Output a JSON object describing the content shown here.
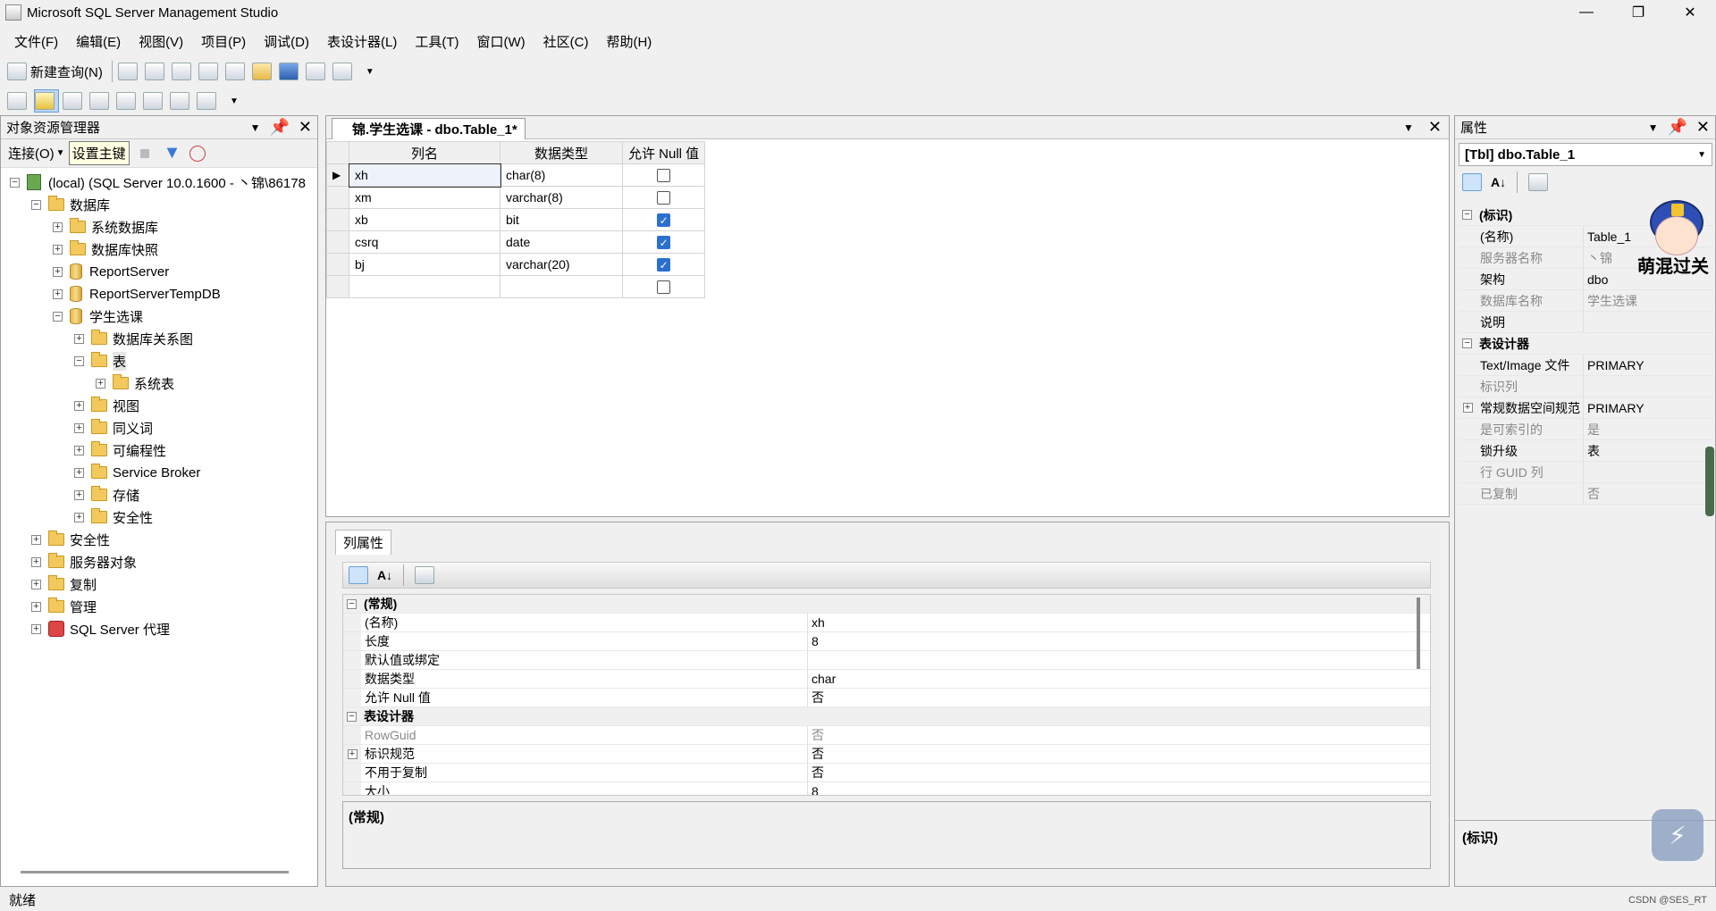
{
  "app": {
    "title": "Microsoft SQL Server Management Studio"
  },
  "menu": [
    "文件(F)",
    "编辑(E)",
    "视图(V)",
    "项目(P)",
    "调试(D)",
    "表设计器(L)",
    "工具(T)",
    "窗口(W)",
    "社区(C)",
    "帮助(H)"
  ],
  "toolbar": {
    "new_query": "新建查询(N)"
  },
  "object_explorer": {
    "title": "对象资源管理器",
    "connect": "连接(O)",
    "tooltip": "设置主键",
    "tree": [
      {
        "label": "(local) (SQL Server 10.0.1600 - 丶锦\\86178",
        "level": 0,
        "exp": "−",
        "icon": "server"
      },
      {
        "label": "数据库",
        "level": 1,
        "exp": "−",
        "icon": "folder"
      },
      {
        "label": "系统数据库",
        "level": 2,
        "exp": "+",
        "icon": "folder"
      },
      {
        "label": "数据库快照",
        "level": 2,
        "exp": "+",
        "icon": "folder"
      },
      {
        "label": "ReportServer",
        "level": 2,
        "exp": "+",
        "icon": "db"
      },
      {
        "label": "ReportServerTempDB",
        "level": 2,
        "exp": "+",
        "icon": "db"
      },
      {
        "label": "学生选课",
        "level": 2,
        "exp": "−",
        "icon": "db"
      },
      {
        "label": "数据库关系图",
        "level": 3,
        "exp": "+",
        "icon": "folder"
      },
      {
        "label": "表",
        "level": 3,
        "exp": "−",
        "icon": "folder"
      },
      {
        "label": "系统表",
        "level": 4,
        "exp": "+",
        "icon": "folder"
      },
      {
        "label": "视图",
        "level": 3,
        "exp": "+",
        "icon": "folder"
      },
      {
        "label": "同义词",
        "level": 3,
        "exp": "+",
        "icon": "folder"
      },
      {
        "label": "可编程性",
        "level": 3,
        "exp": "+",
        "icon": "folder"
      },
      {
        "label": "Service Broker",
        "level": 3,
        "exp": "+",
        "icon": "folder"
      },
      {
        "label": "存储",
        "level": 3,
        "exp": "+",
        "icon": "folder"
      },
      {
        "label": "安全性",
        "level": 3,
        "exp": "+",
        "icon": "folder"
      },
      {
        "label": "安全性",
        "level": 1,
        "exp": "+",
        "icon": "folder"
      },
      {
        "label": "服务器对象",
        "level": 1,
        "exp": "+",
        "icon": "folder"
      },
      {
        "label": "复制",
        "level": 1,
        "exp": "+",
        "icon": "folder"
      },
      {
        "label": "管理",
        "level": 1,
        "exp": "+",
        "icon": "folder"
      },
      {
        "label": "SQL Server 代理",
        "level": 1,
        "exp": "+",
        "icon": "agent"
      }
    ]
  },
  "designer": {
    "tab": "锦.学生选课 - dbo.Table_1*",
    "headers": [
      "列名",
      "数据类型",
      "允许 Null 值"
    ],
    "rows": [
      {
        "name": "xh",
        "type": "char(8)",
        "nullable": false
      },
      {
        "name": "xm",
        "type": "varchar(8)",
        "nullable": false
      },
      {
        "name": "xb",
        "type": "bit",
        "nullable": true
      },
      {
        "name": "csrq",
        "type": "date",
        "nullable": true
      },
      {
        "name": "bj",
        "type": "varchar(20)",
        "nullable": true
      },
      {
        "name": "",
        "type": "",
        "nullable": false
      }
    ]
  },
  "column_props": {
    "tab": "列属性",
    "rows": [
      {
        "kind": "cat",
        "label": "(常规)",
        "exp": "−"
      },
      {
        "label": "(名称)",
        "value": "xh"
      },
      {
        "label": "长度",
        "value": "8"
      },
      {
        "label": "默认值或绑定",
        "value": ""
      },
      {
        "label": "数据类型",
        "value": "char"
      },
      {
        "label": "允许 Null 值",
        "value": "否"
      },
      {
        "kind": "cat",
        "label": "表设计器",
        "exp": "−"
      },
      {
        "label": "RowGuid",
        "value": "否",
        "grey": true
      },
      {
        "label": "标识规范",
        "value": "否",
        "exp": "+"
      },
      {
        "label": "不用于复制",
        "value": "否"
      },
      {
        "label": "大小",
        "value": "8"
      }
    ],
    "desc_title": "(常规)"
  },
  "properties": {
    "title": "属性",
    "object": "[Tbl] dbo.Table_1",
    "rows": [
      {
        "kind": "cat",
        "label": "(标识)",
        "exp": "−"
      },
      {
        "label": "(名称)",
        "value": "Table_1"
      },
      {
        "label": "服务器名称",
        "value": "丶锦",
        "grey": true
      },
      {
        "label": "架构",
        "value": "dbo"
      },
      {
        "label": "数据库名称",
        "value": "学生选课",
        "grey": true
      },
      {
        "label": "说明",
        "value": ""
      },
      {
        "kind": "cat",
        "label": "表设计器",
        "exp": "−"
      },
      {
        "label": "Text/Image 文件",
        "value": "PRIMARY"
      },
      {
        "label": "标识列",
        "value": "",
        "grey": true
      },
      {
        "label": "常规数据空间规范",
        "value": "PRIMARY",
        "exp": "+"
      },
      {
        "label": "是可索引的",
        "value": "是",
        "grey": true
      },
      {
        "label": "锁升级",
        "value": "表"
      },
      {
        "label": "行 GUID 列",
        "value": "",
        "grey": true
      },
      {
        "label": "已复制",
        "value": "否",
        "grey": true
      }
    ],
    "desc_title": "(标识)",
    "sticker_text": "萌混过关"
  },
  "status": {
    "text": "就绪",
    "watermark": "CSDN @SES_RT"
  }
}
